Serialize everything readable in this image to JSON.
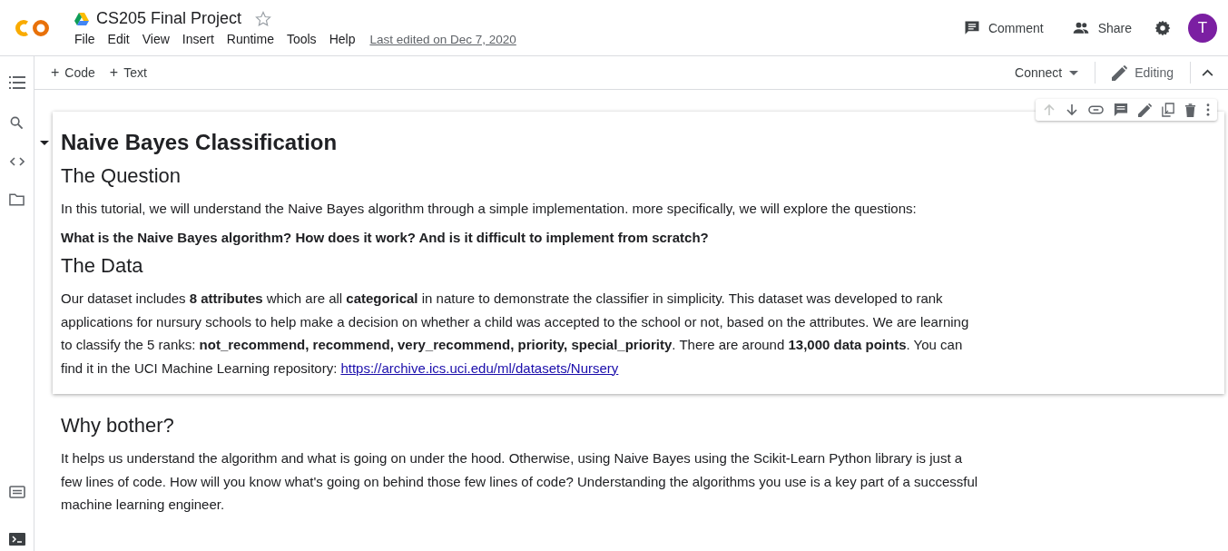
{
  "header": {
    "title": "CS205 Final Project",
    "starred": false,
    "menu": [
      "File",
      "Edit",
      "View",
      "Insert",
      "Runtime",
      "Tools",
      "Help"
    ],
    "last_edited": "Last edited on Dec 7, 2020",
    "comment": "Comment",
    "share": "Share",
    "avatar": "T"
  },
  "toolbar": {
    "plus": "+",
    "add_code": "Code",
    "add_text": "Text",
    "connect": "Connect",
    "editing": "Editing"
  },
  "cells": [
    {
      "selected": true,
      "collapsible": true,
      "blocks": [
        {
          "kind": "h1",
          "text": "Naive Bayes Classification"
        },
        {
          "kind": "h2",
          "text": "The Question"
        },
        {
          "kind": "p",
          "text": "In this tutorial, we will understand the Naive Bayes algorithm through a simple implementation. more specifically, we will explore the questions:"
        },
        {
          "kind": "p",
          "text": "**What is the Naive Bayes algorithm? How does it work? And is it difficult to implement from scratch?**"
        },
        {
          "kind": "h2",
          "text": "The Data"
        },
        {
          "kind": "p",
          "text": "Our dataset includes **8 attributes** which are all **categorical** in nature to demonstrate the classifier in simplicity. This dataset was developed to rank applications for nursury schools to help make a decision on whether a child was accepted to the school or not, based on the attributes. We are learning to classify the 5 ranks: **not_recommend, recommend, very_recommend, priority, special_priority**. There are around **13,000 data points**. You can find it in the UCI Machine Learning repository:",
          "link": "https://archive.ics.uci.edu/ml/datasets/Nursery"
        }
      ]
    },
    {
      "selected": false,
      "collapsible": false,
      "blocks": [
        {
          "kind": "h2",
          "text": "Why bother?"
        },
        {
          "kind": "p",
          "text": "It helps us understand the algorithm and what is going on under the hood. Otherwise, using Naive Bayes using the Scikit-Learn Python library is just a few lines of code. How will you know what's going on behind those few lines of code? Understanding the algorithms you use is a key part of a successful machine learning engineer."
        }
      ]
    }
  ]
}
